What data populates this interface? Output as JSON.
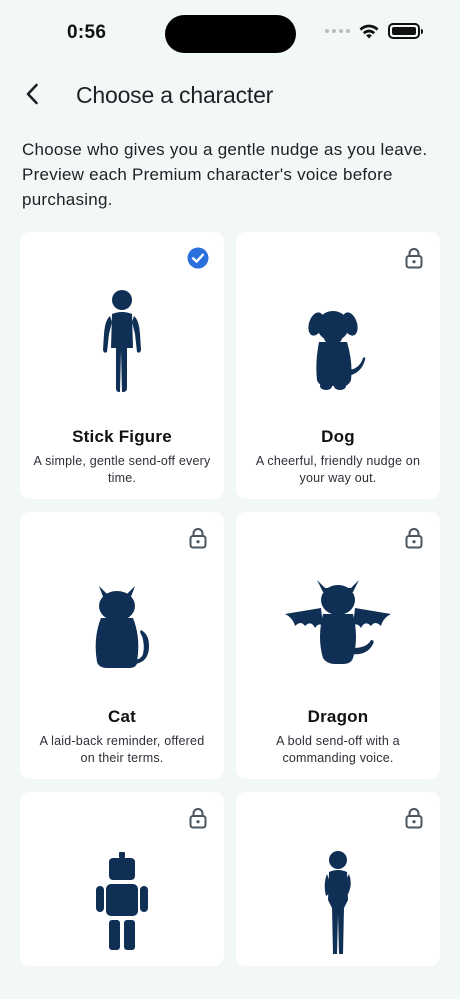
{
  "status_bar": {
    "time": "0:56"
  },
  "header": {
    "title": "Choose a character"
  },
  "intro": "Choose who gives you a gentle nudge as you leave. Preview each Premium character's voice before purchasing.",
  "colors": {
    "accent": "#2a6fdb",
    "figure": "#0f2f55",
    "lock": "#4a5560",
    "background": "#f2f8f6",
    "card": "#ffffff"
  },
  "characters": [
    {
      "name": "Stick Figure",
      "description": "A simple, gentle send-off every time.",
      "selected": true,
      "badge_icon": "checkmark-circle-icon"
    },
    {
      "name": "Dog",
      "description": "A cheerful, friendly nudge on your way out.",
      "locked": true,
      "badge_icon": "lock-icon"
    },
    {
      "name": "Cat",
      "description": "A laid-back reminder, offered on their terms.",
      "locked": true,
      "badge_icon": "lock-icon"
    },
    {
      "name": "Dragon",
      "description": "A bold send-off with a commanding voice.",
      "locked": true,
      "badge_icon": "lock-icon"
    },
    {
      "name": "",
      "description": "",
      "locked": true,
      "badge_icon": "lock-icon"
    },
    {
      "name": "",
      "description": "",
      "locked": true,
      "badge_icon": "lock-icon"
    }
  ]
}
